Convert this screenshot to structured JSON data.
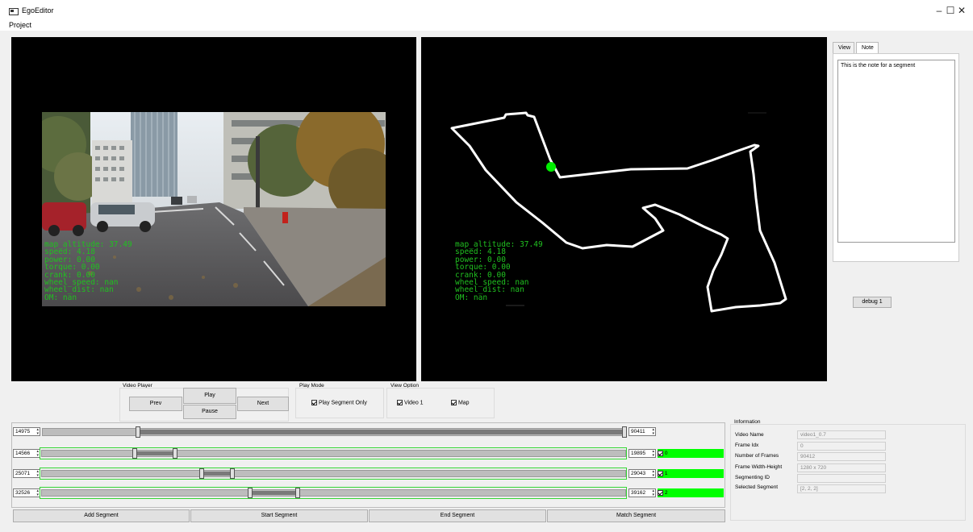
{
  "window": {
    "title": "EgoEditor",
    "minimize": "–",
    "maximize": "☐",
    "close": "✕"
  },
  "menu": {
    "project": "Project"
  },
  "video_overlay": "map_altitude: 37.49\nspeed: 4.18\npower: 0.00\ntorque: 0.00\ncrank: 0.00\nwheel_speed: nan\nwheel_dist: nan\nOM: nan",
  "map_overlay": "map_altitude: 37.49\nspeed: 4.18\npower: 0.00\ntorque: 0.00\ncrank: 0.00\nwheel_speed: nan\nwheel_dist: nan\nOM: nan",
  "side_tabs": {
    "view": "View",
    "note": "Note",
    "note_text": "This is the note for a segment"
  },
  "debug_button": "debug 1",
  "video_player": {
    "title": "Video Player",
    "prev": "Prev",
    "play": "Play",
    "pause": "Pause",
    "next": "Next"
  },
  "play_mode": {
    "title": "Play Mode",
    "segment_only": "Play Segment Only",
    "segment_only_checked": true
  },
  "view_option": {
    "title": "View Option",
    "video1": "Video 1",
    "video1_checked": true,
    "map": "Map",
    "map_checked": true
  },
  "timeline": {
    "main_start": "14975",
    "main_end": "90411",
    "segments": [
      {
        "start": "14566",
        "end": "19895",
        "id": "0",
        "checked": true
      },
      {
        "start": "25071",
        "end": "29043",
        "id": "1",
        "checked": true
      },
      {
        "start": "32526",
        "end": "39162",
        "id": "2",
        "checked": true
      }
    ]
  },
  "segment_buttons": {
    "add": "Add Segment",
    "start": "Start Segment",
    "end": "End Segment",
    "match": "Match Segment"
  },
  "information": {
    "title": "Information",
    "rows": [
      {
        "key": "Video Name",
        "value": "video1_0.7"
      },
      {
        "key": "Frame Idx",
        "value": "0"
      },
      {
        "key": "Number of Frames",
        "value": "90412"
      },
      {
        "key": "Frame Width-Height",
        "value": "1280 x 720"
      },
      {
        "key": "Segmenting ID",
        "value": ""
      },
      {
        "key": "Selected Segment",
        "value": "[2, 2, 2]"
      }
    ]
  },
  "colors": {
    "overlay_text": "#20c020",
    "map_marker": "#00ee00",
    "segment_label_bg": "#00ff00"
  }
}
